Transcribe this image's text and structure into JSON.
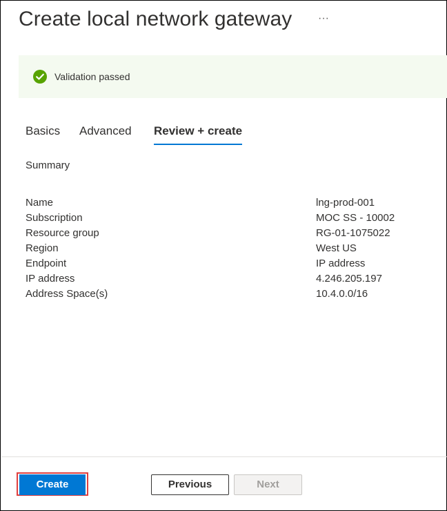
{
  "header": {
    "title": "Create local network gateway",
    "more_label": "···"
  },
  "banner": {
    "status": "success",
    "icon": "check-circle-icon",
    "text": "Validation passed",
    "color": "#57a300",
    "background": "#f4faf0"
  },
  "tabs": [
    {
      "label": "Basics",
      "active": false
    },
    {
      "label": "Advanced",
      "active": false
    },
    {
      "label": "Review + create",
      "active": true
    }
  ],
  "summary": {
    "heading": "Summary",
    "rows": [
      {
        "label": "Name",
        "value": "lng-prod-001"
      },
      {
        "label": "Subscription",
        "value": "MOC SS - 10002"
      },
      {
        "label": "Resource group",
        "value": "RG-01-1075022"
      },
      {
        "label": "Region",
        "value": "West US"
      },
      {
        "label": "Endpoint",
        "value": "IP address"
      },
      {
        "label": "IP address",
        "value": "4.246.205.197"
      },
      {
        "label": "Address Space(s)",
        "value": "10.4.0.0/16"
      }
    ]
  },
  "footer": {
    "create_label": "Create",
    "previous_label": "Previous",
    "next_label": "Next",
    "next_disabled": true,
    "accent_color": "#0078d4",
    "highlight_color": "#e03e3e"
  }
}
